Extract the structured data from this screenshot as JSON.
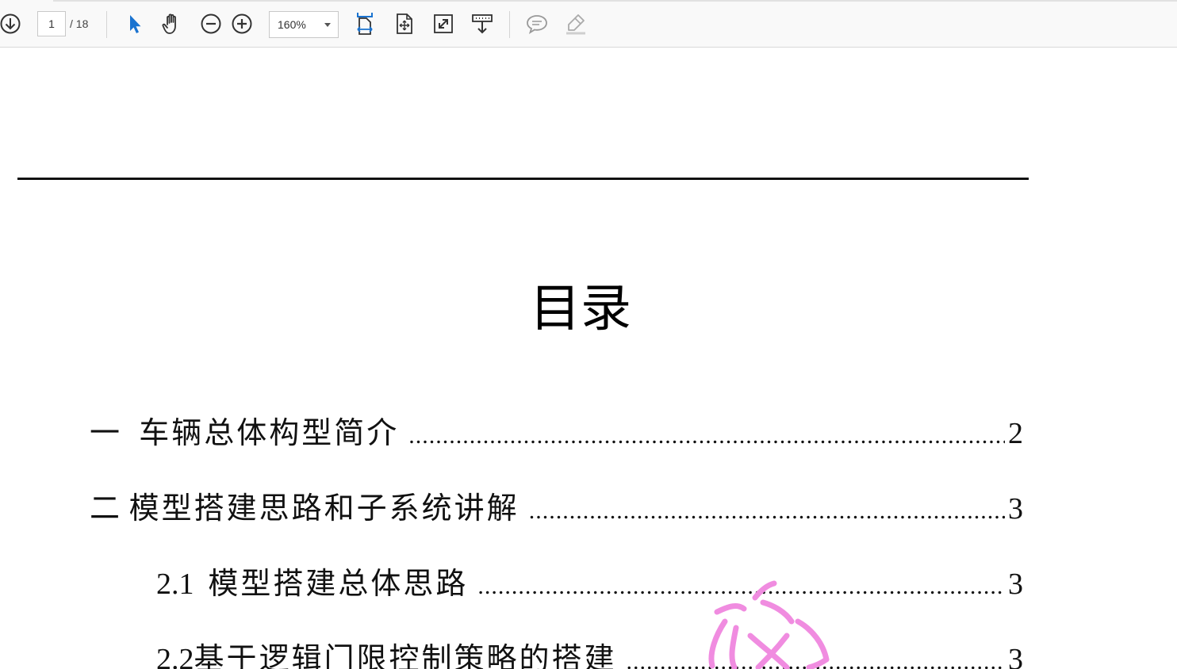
{
  "toolbar": {
    "current_page": "1",
    "page_total": "/ 18",
    "zoom": "160%",
    "icons": [
      "download-icon",
      "select-arrow-icon",
      "hand-icon",
      "zoom-out-icon",
      "zoom-in-icon",
      "fit-width-icon",
      "fit-page-icon",
      "fullscreen-icon",
      "scroll-mode-icon",
      "comment-icon",
      "highlight-icon"
    ],
    "accent_color": "#1a73d0"
  },
  "document": {
    "title": "目录",
    "toc": [
      {
        "num": "一",
        "title": "车辆总体构型简介",
        "page": "2",
        "dots": "..........................................................................................."
      },
      {
        "num": "二",
        "title": "模型搭建思路和子系统讲解",
        "page": "3",
        "dots": "..........................................................................................."
      },
      {
        "num": "2.1",
        "title": "模型搭建总体思路",
        "page": "3",
        "dots": "..........................................................................................."
      },
      {
        "num": "2.2",
        "title": "基于逻辑门限控制策略的搭建",
        "page": "3",
        "dots": "..........................................................................................."
      }
    ],
    "annotation_color": "#f08ce0"
  }
}
